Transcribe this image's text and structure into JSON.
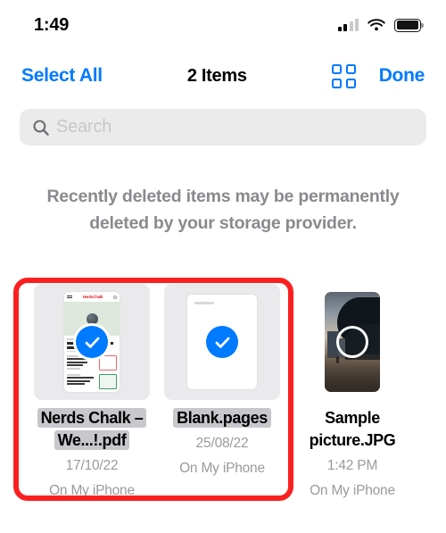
{
  "status_bar": {
    "time": "1:49",
    "signal_icon": "cellular-signal-icon",
    "signal_bars_filled": 2,
    "signal_bars_total": 4,
    "wifi_icon": "wifi-icon",
    "battery_icon": "battery-full-icon"
  },
  "nav_bar": {
    "select_all_label": "Select All",
    "title": "2 Items",
    "grid_view_icon": "grid-view-icon",
    "done_label": "Done"
  },
  "search": {
    "placeholder": "Search",
    "value": "",
    "icon": "search-icon"
  },
  "notice": {
    "text": "Recently deleted items may be permanently deleted by your storage provider."
  },
  "colors": {
    "accent": "#007aff",
    "annotation": "#fb2020",
    "selected_label_bg": "#c7c7cc",
    "search_bg": "#ebebec",
    "thumb_bg": "#eaeaec",
    "muted_text": "#9a9a9e",
    "notice_text": "#8a8a8e"
  },
  "files": [
    {
      "name": "Nerds Chalk – We...!.pdf",
      "date": "17/10/22",
      "location": "On My iPhone",
      "selected": true,
      "thumbnail_type": "pdf-webpage-preview",
      "badge_icon": "checkmark-circle-filled-icon",
      "preview": {
        "site_logo": "NerdsChalk",
        "headline": "How to fix critical list on Windows 11"
      }
    },
    {
      "name": "Blank.pages",
      "date": "25/08/22",
      "location": "On My iPhone",
      "selected": true,
      "thumbnail_type": "pages-document-preview",
      "badge_icon": "checkmark-circle-filled-icon",
      "preview": {
        "site_logo": "",
        "headline": ""
      }
    },
    {
      "name": "Sample picture.JPG",
      "date": "1:42 PM",
      "location": "On My iPhone",
      "selected": false,
      "thumbnail_type": "photo-preview",
      "badge_icon": "selection-circle-empty-icon",
      "preview": {
        "site_logo": "",
        "headline": ""
      }
    }
  ],
  "annotation": {
    "name": "red-highlight-box"
  }
}
